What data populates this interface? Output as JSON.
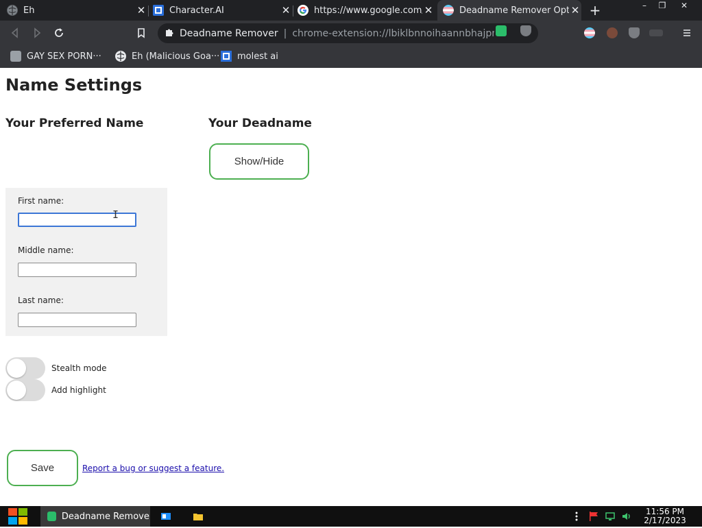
{
  "browser": {
    "tabs": [
      {
        "title": "Eh",
        "active": false
      },
      {
        "title": "Character.AI",
        "active": false
      },
      {
        "title": "https://www.google.com/se",
        "active": false
      },
      {
        "title": "Deadname Remover Option",
        "active": true
      }
    ],
    "new_tab_label": "+",
    "window_controls": {
      "minimize": "–",
      "restore": "❐",
      "close": "✕"
    },
    "omnibox": {
      "site_name": "Deadname Remover",
      "separator": "|",
      "url": "chrome-extension://lbiklbnnoihaannbhajpmp···"
    },
    "bookmarks": [
      {
        "label": "GAY SEX PORN···",
        "icon": "bookmark-favicon-icon"
      },
      {
        "label": "Eh (Malicious Goa···",
        "icon": "globe-icon"
      },
      {
        "label": "molest ai",
        "icon": "character-ai-icon"
      }
    ]
  },
  "page": {
    "title": "Name Settings",
    "preferred_heading": "Your Preferred Name",
    "deadname_heading": "Your Deadname",
    "show_hide_label": "Show/Hide",
    "fields": [
      {
        "label": "First name:",
        "value": ""
      },
      {
        "label": "Middle name:",
        "value": ""
      },
      {
        "label": "Last name:",
        "value": ""
      }
    ],
    "toggles": [
      {
        "label": "Stealth mode",
        "on": false
      },
      {
        "label": "Add highlight",
        "on": false
      }
    ],
    "save_label": "Save",
    "report_link": "Report a bug or suggest a feature.",
    "accent_color": "#4caf50"
  },
  "taskbar": {
    "active_app": "Deadname Remove...",
    "time": "11:56 PM",
    "date": "2/17/2023"
  }
}
